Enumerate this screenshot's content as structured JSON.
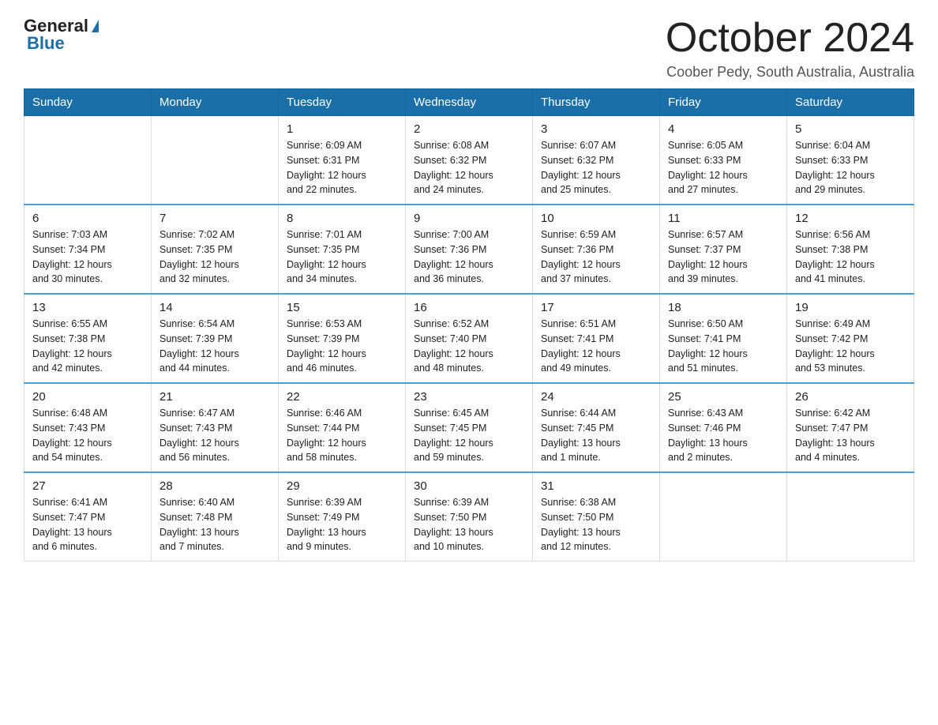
{
  "logo": {
    "text_general": "General",
    "text_blue": "Blue"
  },
  "header": {
    "title": "October 2024",
    "subtitle": "Coober Pedy, South Australia, Australia"
  },
  "weekdays": [
    "Sunday",
    "Monday",
    "Tuesday",
    "Wednesday",
    "Thursday",
    "Friday",
    "Saturday"
  ],
  "weeks": [
    [
      {
        "day": "",
        "info": ""
      },
      {
        "day": "",
        "info": ""
      },
      {
        "day": "1",
        "info": "Sunrise: 6:09 AM\nSunset: 6:31 PM\nDaylight: 12 hours\nand 22 minutes."
      },
      {
        "day": "2",
        "info": "Sunrise: 6:08 AM\nSunset: 6:32 PM\nDaylight: 12 hours\nand 24 minutes."
      },
      {
        "day": "3",
        "info": "Sunrise: 6:07 AM\nSunset: 6:32 PM\nDaylight: 12 hours\nand 25 minutes."
      },
      {
        "day": "4",
        "info": "Sunrise: 6:05 AM\nSunset: 6:33 PM\nDaylight: 12 hours\nand 27 minutes."
      },
      {
        "day": "5",
        "info": "Sunrise: 6:04 AM\nSunset: 6:33 PM\nDaylight: 12 hours\nand 29 minutes."
      }
    ],
    [
      {
        "day": "6",
        "info": "Sunrise: 7:03 AM\nSunset: 7:34 PM\nDaylight: 12 hours\nand 30 minutes."
      },
      {
        "day": "7",
        "info": "Sunrise: 7:02 AM\nSunset: 7:35 PM\nDaylight: 12 hours\nand 32 minutes."
      },
      {
        "day": "8",
        "info": "Sunrise: 7:01 AM\nSunset: 7:35 PM\nDaylight: 12 hours\nand 34 minutes."
      },
      {
        "day": "9",
        "info": "Sunrise: 7:00 AM\nSunset: 7:36 PM\nDaylight: 12 hours\nand 36 minutes."
      },
      {
        "day": "10",
        "info": "Sunrise: 6:59 AM\nSunset: 7:36 PM\nDaylight: 12 hours\nand 37 minutes."
      },
      {
        "day": "11",
        "info": "Sunrise: 6:57 AM\nSunset: 7:37 PM\nDaylight: 12 hours\nand 39 minutes."
      },
      {
        "day": "12",
        "info": "Sunrise: 6:56 AM\nSunset: 7:38 PM\nDaylight: 12 hours\nand 41 minutes."
      }
    ],
    [
      {
        "day": "13",
        "info": "Sunrise: 6:55 AM\nSunset: 7:38 PM\nDaylight: 12 hours\nand 42 minutes."
      },
      {
        "day": "14",
        "info": "Sunrise: 6:54 AM\nSunset: 7:39 PM\nDaylight: 12 hours\nand 44 minutes."
      },
      {
        "day": "15",
        "info": "Sunrise: 6:53 AM\nSunset: 7:39 PM\nDaylight: 12 hours\nand 46 minutes."
      },
      {
        "day": "16",
        "info": "Sunrise: 6:52 AM\nSunset: 7:40 PM\nDaylight: 12 hours\nand 48 minutes."
      },
      {
        "day": "17",
        "info": "Sunrise: 6:51 AM\nSunset: 7:41 PM\nDaylight: 12 hours\nand 49 minutes."
      },
      {
        "day": "18",
        "info": "Sunrise: 6:50 AM\nSunset: 7:41 PM\nDaylight: 12 hours\nand 51 minutes."
      },
      {
        "day": "19",
        "info": "Sunrise: 6:49 AM\nSunset: 7:42 PM\nDaylight: 12 hours\nand 53 minutes."
      }
    ],
    [
      {
        "day": "20",
        "info": "Sunrise: 6:48 AM\nSunset: 7:43 PM\nDaylight: 12 hours\nand 54 minutes."
      },
      {
        "day": "21",
        "info": "Sunrise: 6:47 AM\nSunset: 7:43 PM\nDaylight: 12 hours\nand 56 minutes."
      },
      {
        "day": "22",
        "info": "Sunrise: 6:46 AM\nSunset: 7:44 PM\nDaylight: 12 hours\nand 58 minutes."
      },
      {
        "day": "23",
        "info": "Sunrise: 6:45 AM\nSunset: 7:45 PM\nDaylight: 12 hours\nand 59 minutes."
      },
      {
        "day": "24",
        "info": "Sunrise: 6:44 AM\nSunset: 7:45 PM\nDaylight: 13 hours\nand 1 minute."
      },
      {
        "day": "25",
        "info": "Sunrise: 6:43 AM\nSunset: 7:46 PM\nDaylight: 13 hours\nand 2 minutes."
      },
      {
        "day": "26",
        "info": "Sunrise: 6:42 AM\nSunset: 7:47 PM\nDaylight: 13 hours\nand 4 minutes."
      }
    ],
    [
      {
        "day": "27",
        "info": "Sunrise: 6:41 AM\nSunset: 7:47 PM\nDaylight: 13 hours\nand 6 minutes."
      },
      {
        "day": "28",
        "info": "Sunrise: 6:40 AM\nSunset: 7:48 PM\nDaylight: 13 hours\nand 7 minutes."
      },
      {
        "day": "29",
        "info": "Sunrise: 6:39 AM\nSunset: 7:49 PM\nDaylight: 13 hours\nand 9 minutes."
      },
      {
        "day": "30",
        "info": "Sunrise: 6:39 AM\nSunset: 7:50 PM\nDaylight: 13 hours\nand 10 minutes."
      },
      {
        "day": "31",
        "info": "Sunrise: 6:38 AM\nSunset: 7:50 PM\nDaylight: 13 hours\nand 12 minutes."
      },
      {
        "day": "",
        "info": ""
      },
      {
        "day": "",
        "info": ""
      }
    ]
  ]
}
